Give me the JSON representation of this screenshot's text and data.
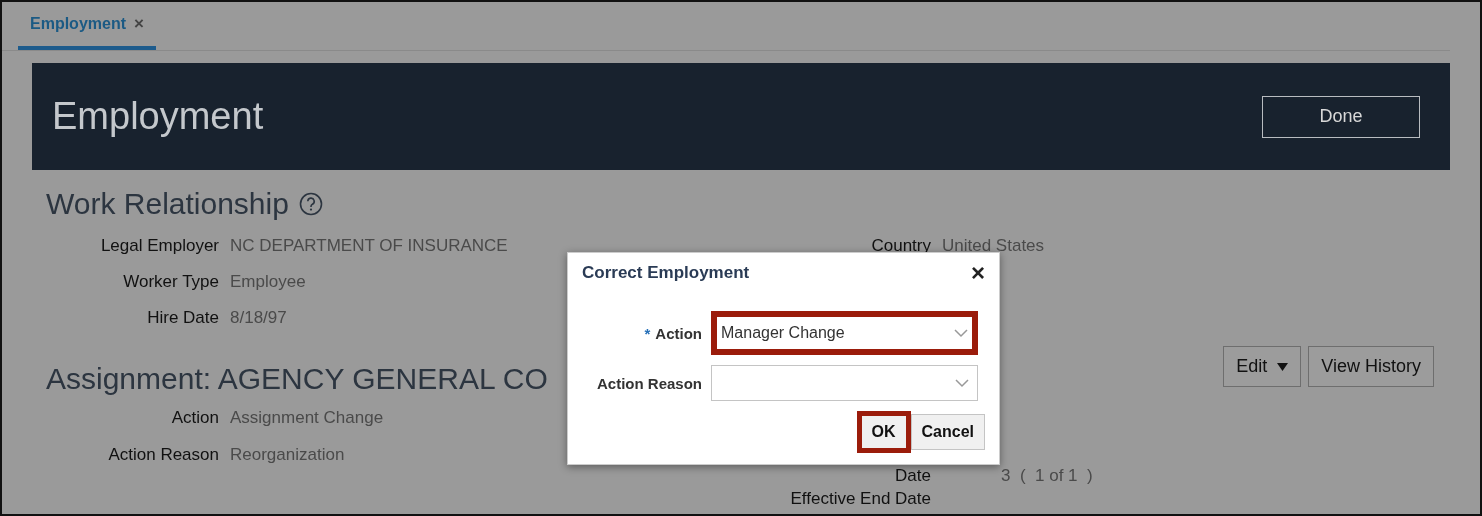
{
  "tabs": [
    {
      "label": "Employment",
      "close": "×",
      "selected": true
    }
  ],
  "header": {
    "title": "Employment",
    "done_button": "Done"
  },
  "work_relationship": {
    "title": "Work Relationship",
    "left_fields": [
      {
        "label": "Legal Employer",
        "value": "NC DEPARTMENT OF INSURANCE"
      },
      {
        "label": "Worker Type",
        "value": "Employee"
      },
      {
        "label": "Hire Date",
        "value": "8/18/97"
      }
    ],
    "right_fields": [
      {
        "label": "Country",
        "value": "United States"
      }
    ]
  },
  "assignment": {
    "title": "Assignment: AGENCY GENERAL CO",
    "edit_button": "Edit",
    "view_history_button": "View History",
    "left_fields": [
      {
        "label": "Action",
        "value": "Assignment Change"
      },
      {
        "label": "Action Reason",
        "value": "Reorganization"
      }
    ],
    "right_fields": [
      {
        "label": "Date",
        "value": "3  (  1 of 1  )"
      },
      {
        "label": "Effective End Date"
      }
    ]
  },
  "dialog": {
    "title": "Correct Employment",
    "close": "×",
    "fields": [
      {
        "label": "Action",
        "required_mark": "*",
        "value": "Manager Change",
        "highlighted": true
      },
      {
        "label": "Action Reason",
        "highlighted": false
      }
    ],
    "buttons": [
      {
        "label": "OK",
        "highlighted": true
      },
      {
        "label": "Cancel",
        "highlighted": false
      }
    ]
  }
}
